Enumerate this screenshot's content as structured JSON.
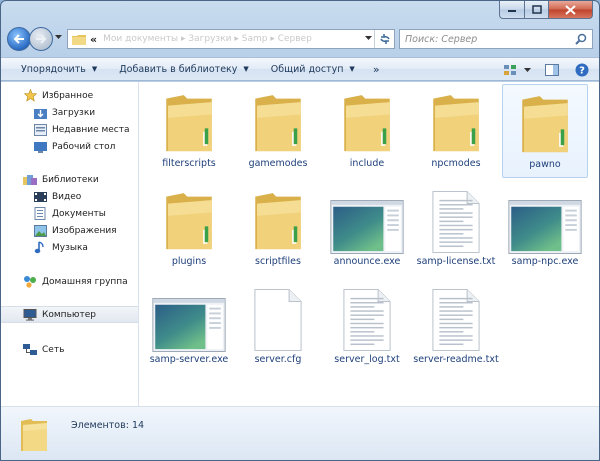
{
  "window": {
    "search_placeholder": "Поиск: Сервер",
    "address": {
      "overflow_chevron": "«",
      "crumb": "Мои документы ▸ Загрузки ▸ Samp ▸ Сервер"
    }
  },
  "toolbar": {
    "organize": "Упорядочить",
    "add_to_library": "Добавить в библиотеку",
    "share": "Общий доступ",
    "more": "»"
  },
  "nav": {
    "favorites": {
      "label": "Избранное",
      "items": [
        "Загрузки",
        "Недавние места",
        "Рабочий стол"
      ]
    },
    "libraries": {
      "label": "Библиотеки",
      "items": [
        "Видео",
        "Документы",
        "Изображения",
        "Музыка"
      ]
    },
    "homegroup": "Домашняя группа",
    "computer": "Компьютер",
    "network": "Сеть"
  },
  "files": [
    {
      "name": "filterscripts",
      "type": "folder"
    },
    {
      "name": "gamemodes",
      "type": "folder"
    },
    {
      "name": "include",
      "type": "folder"
    },
    {
      "name": "npcmodes",
      "type": "folder"
    },
    {
      "name": "pawno",
      "type": "folder",
      "selected": true
    },
    {
      "name": "plugins",
      "type": "folder"
    },
    {
      "name": "scriptfiles",
      "type": "folder"
    },
    {
      "name": "announce.exe",
      "type": "exe"
    },
    {
      "name": "samp-license.txt",
      "type": "txt"
    },
    {
      "name": "samp-npc.exe",
      "type": "exe"
    },
    {
      "name": "samp-server.exe",
      "type": "exe"
    },
    {
      "name": "server.cfg",
      "type": "blank"
    },
    {
      "name": "server_log.txt",
      "type": "txt"
    },
    {
      "name": "server-readme.txt",
      "type": "txt"
    }
  ],
  "status": {
    "items_text": "Элементов: 14"
  },
  "colors": {
    "accent": "#1e3f7a",
    "folder": "#f0d27a",
    "selection": "#e8f2fd"
  }
}
